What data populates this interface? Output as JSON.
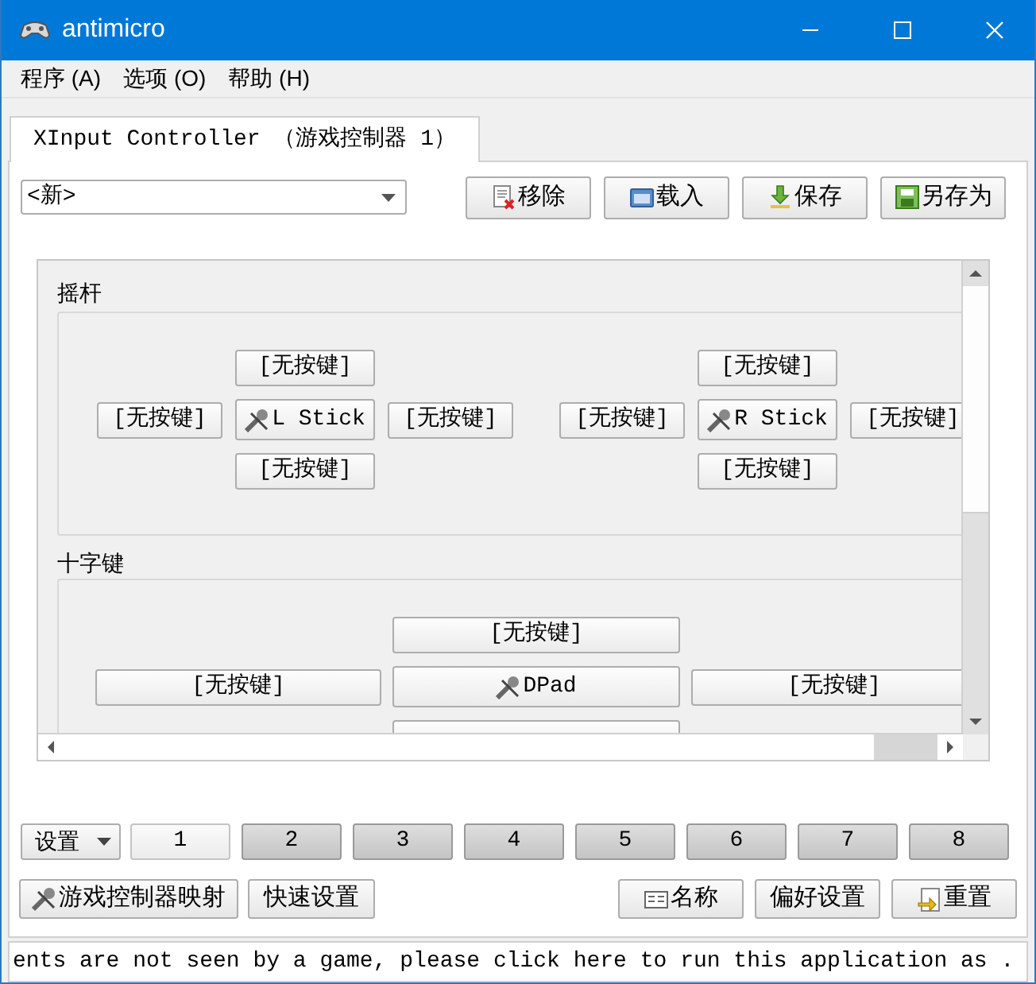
{
  "window": {
    "title": "antimicro"
  },
  "menu": [
    {
      "label": "程序 (A)"
    },
    {
      "label": "选项 (O)"
    },
    {
      "label": "帮助 (H)"
    }
  ],
  "tabs": [
    {
      "label": "XInput Controller （游戏控制器 1）",
      "selected": true
    }
  ],
  "profile": {
    "value": "<新>"
  },
  "profile_buttons": [
    {
      "label": "移除"
    },
    {
      "label": "载入"
    },
    {
      "label": "保存"
    },
    {
      "label": "另存为"
    }
  ],
  "sticks": {
    "title": "摇杆",
    "groups": [
      {
        "up": "[无按键]",
        "left": "[无按键]",
        "center": "L Stick",
        "right": "[无按键]",
        "down": "[无按键]"
      },
      {
        "up": "[无按键]",
        "left": "[无按键]",
        "center": "R Stick",
        "right": "[无按键]",
        "down": "[无按键]"
      }
    ]
  },
  "dpad": {
    "title": "十字键",
    "up": "[无按键]",
    "left": "[无按键]",
    "center": "DPad",
    "right": "[无按键]"
  },
  "sets": {
    "label": "设置",
    "items": [
      {
        "label": "1",
        "selected": true
      },
      {
        "label": "2",
        "selected": false
      },
      {
        "label": "3",
        "selected": false
      },
      {
        "label": "4",
        "selected": false
      },
      {
        "label": "5",
        "selected": false
      },
      {
        "label": "6",
        "selected": false
      },
      {
        "label": "7",
        "selected": false
      },
      {
        "label": "8",
        "selected": false
      }
    ]
  },
  "left_buttons": [
    {
      "label": "游戏控制器映射"
    },
    {
      "label": "快速设置"
    }
  ],
  "right_buttons": [
    {
      "label": "名称"
    },
    {
      "label": "偏好设置"
    },
    {
      "label": "重置"
    }
  ],
  "status_bar": "ents are not seen by a game, please click here to run this application as ."
}
